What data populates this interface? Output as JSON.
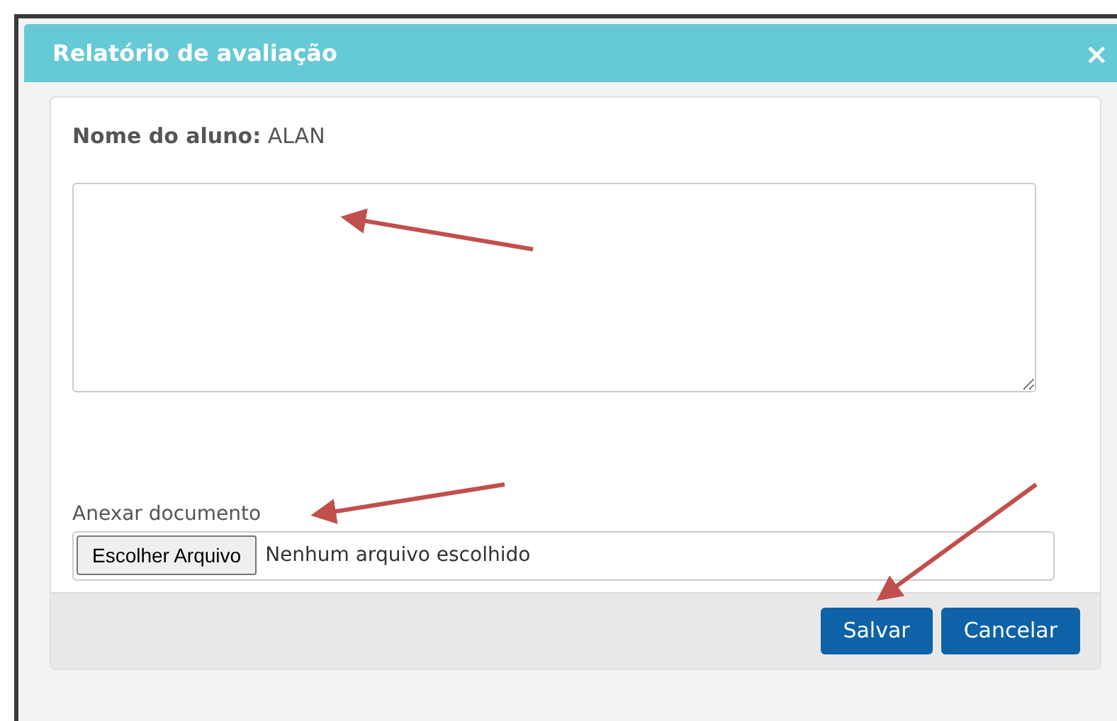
{
  "dialog": {
    "title": "Relatório de avaliação",
    "close": "×"
  },
  "student": {
    "label": "Nome do aluno:",
    "value": "ALAN"
  },
  "attachment": {
    "label": "Anexar documento",
    "button": "Escolher Arquivo",
    "status": "Nenhum arquivo escolhido"
  },
  "buttons": [
    {
      "label": "Salvar"
    },
    {
      "label": "Cancelar"
    }
  ]
}
